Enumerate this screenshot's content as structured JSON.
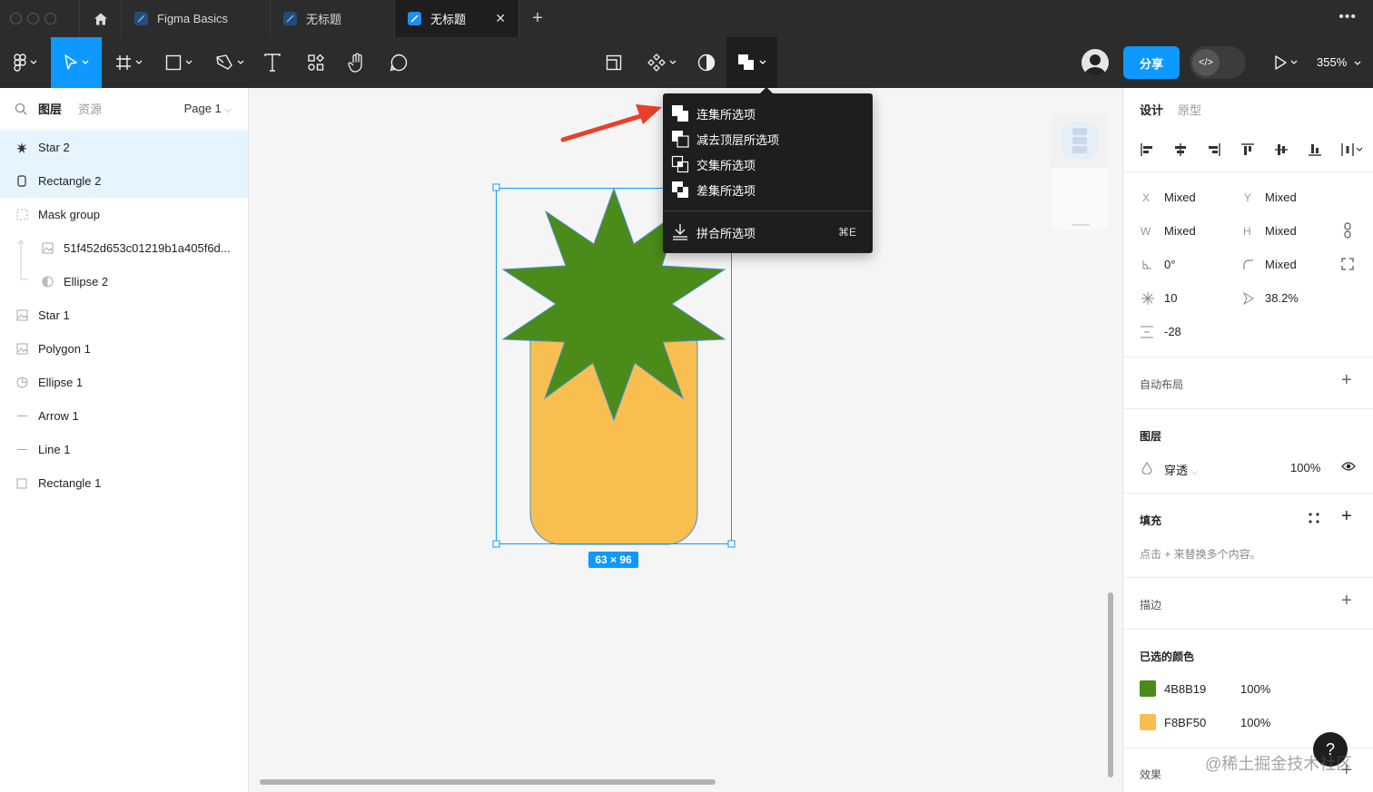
{
  "tabs": {
    "items": [
      {
        "label": "Figma Basics"
      },
      {
        "label": "无标题"
      },
      {
        "label": "无标题",
        "active": true
      }
    ],
    "close": "✕",
    "add": "+"
  },
  "toolbar": {
    "share_label": "分享",
    "dev_mode_label": "</>",
    "zoom": "355%"
  },
  "left_panel": {
    "tabs": [
      "图层",
      "资源"
    ],
    "page": "Page 1",
    "layers": [
      {
        "name": "Star 2",
        "icon": "star-icon",
        "selected": true
      },
      {
        "name": "Rectangle 2",
        "icon": "rectangle-icon",
        "selected": true
      },
      {
        "name": "Mask group",
        "icon": "mask-group-icon"
      },
      {
        "name": "51f452d653c01219b1a405f6d...",
        "icon": "image-icon",
        "child": true
      },
      {
        "name": "Ellipse 2",
        "icon": "ellipse-mask-icon",
        "child": true
      },
      {
        "name": "Star 1",
        "icon": "image-icon"
      },
      {
        "name": "Polygon 1",
        "icon": "image-icon"
      },
      {
        "name": "Ellipse 1",
        "icon": "ellipse-icon"
      },
      {
        "name": "Arrow 1",
        "icon": "line-icon"
      },
      {
        "name": "Line 1",
        "icon": "line-icon"
      },
      {
        "name": "Rectangle 1",
        "icon": "rectangle-icon"
      }
    ]
  },
  "menu": {
    "items": [
      {
        "label": "连集所选项",
        "icon": "union-icon"
      },
      {
        "label": "减去顶层所选项",
        "icon": "subtract-icon"
      },
      {
        "label": "交集所选项",
        "icon": "intersect-icon"
      },
      {
        "label": "差集所选项",
        "icon": "exclude-icon"
      }
    ],
    "flatten": {
      "label": "拼合所选项",
      "shortcut": "⌘E",
      "icon": "flatten-icon"
    }
  },
  "canvas": {
    "dimensions": "63 × 96",
    "colors": {
      "star": "#4B8B19",
      "rectangle": "#F8BF50",
      "selection": "#0D99FF"
    }
  },
  "right_panel": {
    "tabs": [
      "设计",
      "原型"
    ],
    "x_label": "X",
    "x": "Mixed",
    "y_label": "Y",
    "y": "Mixed",
    "w_label": "W",
    "w": "Mixed",
    "h_label": "H",
    "h": "Mixed",
    "rotation": "0°",
    "radius": "Mixed",
    "points": "10",
    "ratio": "38.2%",
    "spacing": "-28",
    "auto_layout": "自动布局",
    "layer_title": "图层",
    "blend": "穿透",
    "opacity": "100%",
    "fill_title": "填充",
    "fill_hint": "点击 + 来替换多个内容。",
    "stroke_title": "描边",
    "selected_colors_title": "已选的颜色",
    "selected_colors": [
      {
        "hex": "4B8B19",
        "color": "#4B8B19",
        "opacity": "100%"
      },
      {
        "hex": "F8BF50",
        "color": "#F8BF50",
        "opacity": "100%"
      }
    ],
    "effects_title": "效果"
  },
  "help": "?",
  "watermark": "@稀土掘金技术社区"
}
